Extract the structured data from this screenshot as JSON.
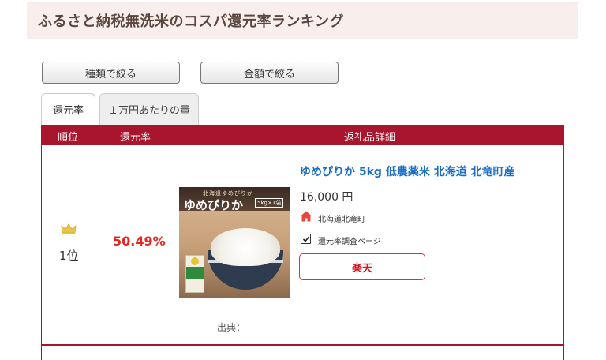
{
  "header": {
    "title": "ふるさと納税無洗米のコスパ還元率ランキング"
  },
  "filters": {
    "type_label": "種類で絞る",
    "amount_label": "金額で絞る"
  },
  "tabs": [
    {
      "label": "還元率",
      "active": true
    },
    {
      "label": "１万円あたりの量",
      "active": false
    }
  ],
  "table": {
    "columns": {
      "rank": "順位",
      "rate": "還元率",
      "detail": "返礼品詳細"
    },
    "rows": [
      {
        "rank_icon": "crown-icon",
        "rank": "1位",
        "rate": "50.49%",
        "image": {
          "small_text": "北海道ゆめぴりか",
          "title": "ゆめぴりか",
          "tag": "5kg×1袋"
        },
        "product_name": "ゆめぴりか 5kg 低農薬米 北海道 北竜町産",
        "price": "16,000 円",
        "location_icon": "home-icon",
        "location": "北海道北竜町",
        "checkbox_label": "還元率調査ページ",
        "checkbox_checked": true,
        "shop_button": "楽天",
        "source_label": "出典："
      }
    ]
  },
  "colors": {
    "accent": "#a8152c",
    "rate": "#e8251f",
    "link": "#1a6fc4",
    "home_icon": "#e8453c",
    "crown": "#e8c547"
  }
}
